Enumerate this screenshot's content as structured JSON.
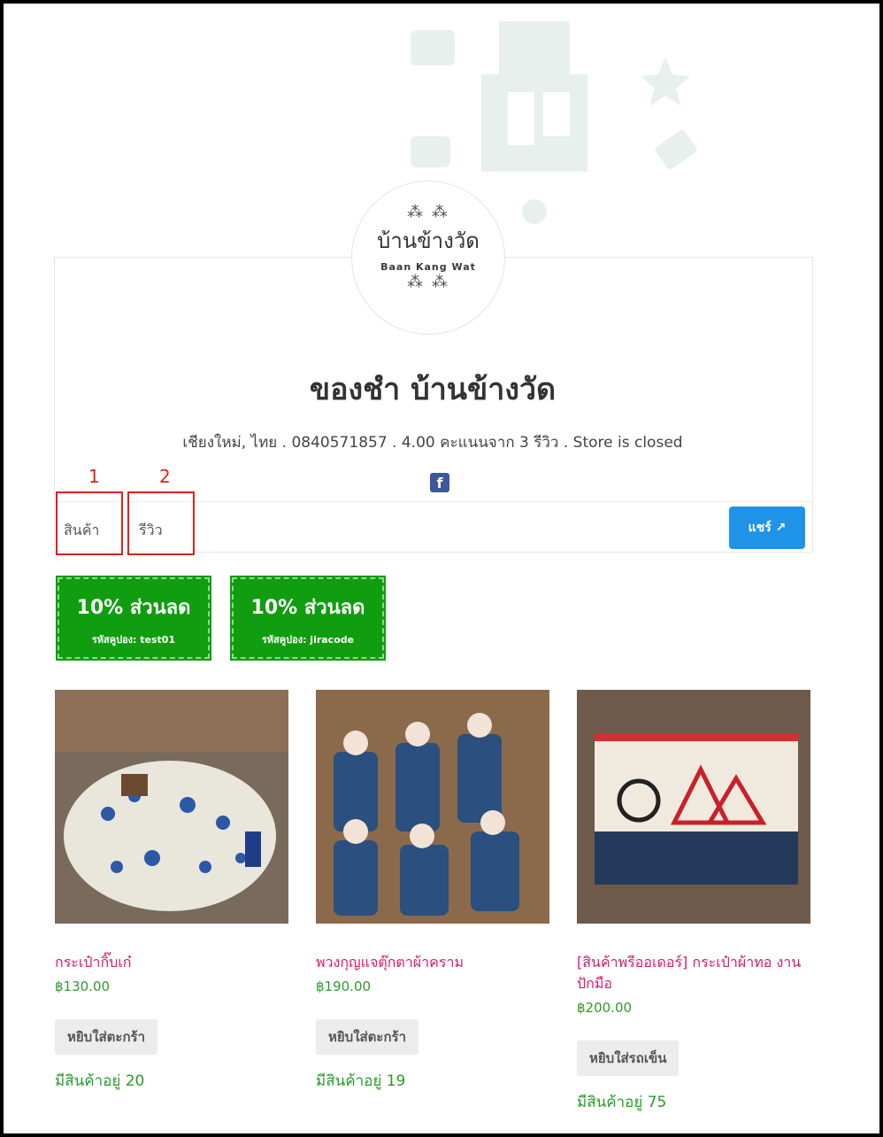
{
  "store": {
    "logo_thai": "บ้านข้างวัด",
    "logo_latin": "Baan Kang Wat",
    "title": "ของชำ บ้านข้างวัด",
    "meta": "เชียงใหม่, ไทย . 0840571857 . 4.00 คะแนนจาก 3 รีวิว . Store is closed"
  },
  "tabs": [
    {
      "label": "สินค้า"
    },
    {
      "label": "รีวิว"
    }
  ],
  "annotations": [
    "1",
    "2"
  ],
  "share_label": "แชร์ ↗",
  "coupons": [
    {
      "title": "10% ส่วนลด",
      "code": "รหัสคูปอง: test01"
    },
    {
      "title": "10% ส่วนลด",
      "code": "รหัสคูปอง: jiracode"
    }
  ],
  "products": [
    {
      "name": "กระเป๋ากิ๊บเก๋",
      "price": "฿130.00",
      "button": "หยิบใส่ตะกร้า",
      "stock": "มีสินค้าอยู่ 20"
    },
    {
      "name": "พวงกุญแจตุ๊กตาผ้าคราม",
      "price": "฿190.00",
      "button": "หยิบใส่ตะกร้า",
      "stock": "มีสินค้าอยู่ 19"
    },
    {
      "name": "[สินค้าพรีออเดอร์] กระเป๋าผ้าทอ งานปักมือ",
      "price": "฿200.00",
      "button": "หยิบใส่รถเข็น",
      "stock": "มีสินค้าอยู่ 75"
    }
  ],
  "colors": {
    "accent_blue": "#1e93e8",
    "coupon_green": "#109d0f",
    "product_name_pink": "#d61c6a",
    "price_green": "#2f9a2f",
    "annotation_red": "#e0201e"
  }
}
